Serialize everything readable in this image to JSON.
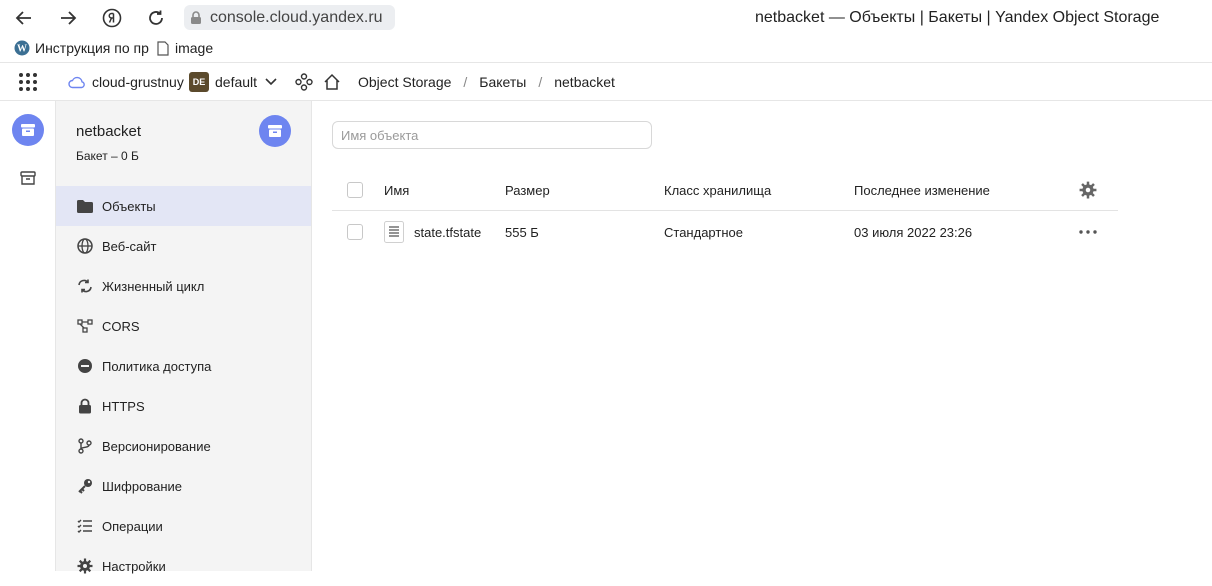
{
  "browser": {
    "url": "console.cloud.yandex.ru",
    "page_title": "netbacket — Объекты | Бакеты | Yandex Object Storage"
  },
  "bookmarks": [
    {
      "label": "Инструкция по пр",
      "icon": "wordpress-icon"
    },
    {
      "label": "image",
      "icon": "document-icon"
    }
  ],
  "header": {
    "cloud": "cloud-grustnuy",
    "folder_badge": "DE",
    "folder": "default",
    "breadcrumbs": [
      "Object Storage",
      "Бакеты",
      "netbacket"
    ],
    "separator": "/"
  },
  "sidebar": {
    "bucket_name": "netbacket",
    "bucket_info": "Бакет – 0 Б",
    "items": [
      {
        "label": "Объекты",
        "icon": "folder-icon",
        "active": true
      },
      {
        "label": "Веб-сайт",
        "icon": "globe-icon"
      },
      {
        "label": "Жизненный цикл",
        "icon": "cycle-icon"
      },
      {
        "label": "CORS",
        "icon": "cors-icon"
      },
      {
        "label": "Политика доступа",
        "icon": "no-entry-icon"
      },
      {
        "label": "HTTPS",
        "icon": "lock-icon"
      },
      {
        "label": "Версионирование",
        "icon": "branch-icon"
      },
      {
        "label": "Шифрование",
        "icon": "key-icon"
      },
      {
        "label": "Операции",
        "icon": "list-icon"
      },
      {
        "label": "Настройки",
        "icon": "gear-icon"
      }
    ]
  },
  "main": {
    "search_placeholder": "Имя объекта",
    "columns": [
      "Имя",
      "Размер",
      "Класс хранилища",
      "Последнее изменение"
    ],
    "rows": [
      {
        "name": "state.tfstate",
        "size": "555 Б",
        "storage_class": "Стандартное",
        "modified": "03 июля 2022 23:26"
      }
    ]
  },
  "colors": {
    "accent": "#6e85f0",
    "active_item": "#e3e6f5",
    "sidebar_bg": "#f4f4f4",
    "badge": "#5b4a2c"
  }
}
